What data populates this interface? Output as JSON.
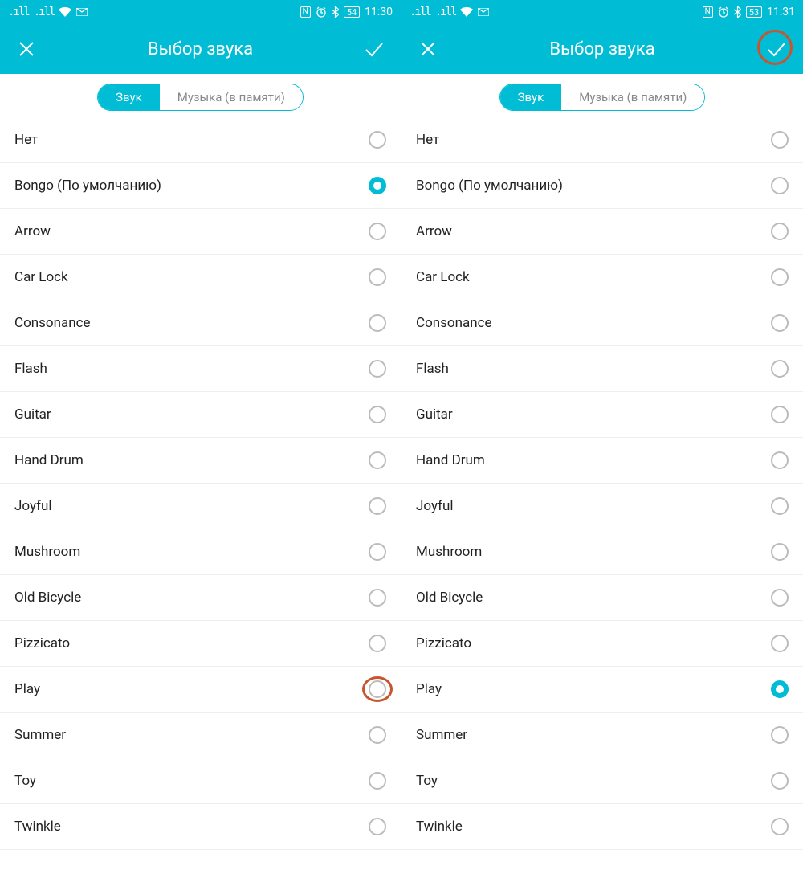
{
  "screens": [
    {
      "id": "left",
      "status": {
        "battery": "54",
        "time": "11:30"
      },
      "title": "Выбор звука",
      "tabs": {
        "sound": "Звук",
        "music": "Музыка (в памяти)",
        "active": "sound"
      },
      "selected_index": 1,
      "highlight_radio_index": 12,
      "highlight_confirm": false
    },
    {
      "id": "right",
      "status": {
        "battery": "53",
        "time": "11:31"
      },
      "title": "Выбор звука",
      "tabs": {
        "sound": "Звук",
        "music": "Музыка (в памяти)",
        "active": "sound"
      },
      "selected_index": 12,
      "highlight_radio_index": -1,
      "highlight_confirm": true
    }
  ],
  "sounds": [
    "Нет",
    "Bongo (По умолчанию)",
    "Arrow",
    "Car Lock",
    "Consonance",
    "Flash",
    "Guitar",
    "Hand Drum",
    "Joyful",
    "Mushroom",
    "Old Bicycle",
    "Pizzicato",
    "Play",
    "Summer",
    "Toy",
    "Twinkle"
  ],
  "colors": {
    "accent": "#00bcd4",
    "highlight": "#c7552f"
  }
}
